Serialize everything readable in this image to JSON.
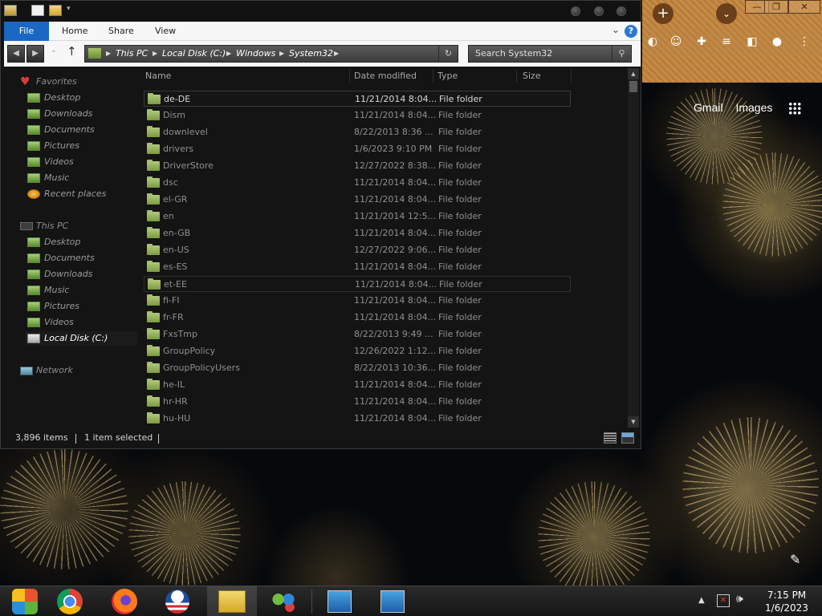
{
  "explorer": {
    "ribbon": {
      "tabs": [
        "File",
        "Home",
        "Share",
        "View"
      ],
      "help": "?"
    },
    "address": {
      "crumbs": [
        "This PC",
        "Local Disk (C:)",
        "Windows",
        "System32"
      ]
    },
    "search": {
      "placeholder": "Search System32"
    },
    "nav": {
      "favorites_label": "Favorites",
      "favorites": [
        "Desktop",
        "Downloads",
        "Documents",
        "Pictures",
        "Videos",
        "Music",
        "Recent places"
      ],
      "thispc_label": "This PC",
      "thispc": [
        "Desktop",
        "Documents",
        "Downloads",
        "Music",
        "Pictures",
        "Videos",
        "Local Disk (C:)"
      ],
      "network_label": "Network"
    },
    "columns": {
      "name": "Name",
      "date": "Date modified",
      "type": "Type",
      "size": "Size"
    },
    "rows": [
      {
        "name": "de-DE",
        "date": "11/21/2014 8:04...",
        "type": "File folder"
      },
      {
        "name": "Dism",
        "date": "11/21/2014 8:04...",
        "type": "File folder"
      },
      {
        "name": "downlevel",
        "date": "8/22/2013 8:36 ...",
        "type": "File folder"
      },
      {
        "name": "drivers",
        "date": "1/6/2023 9:10 PM",
        "type": "File folder"
      },
      {
        "name": "DriverStore",
        "date": "12/27/2022 8:38...",
        "type": "File folder"
      },
      {
        "name": "dsc",
        "date": "11/21/2014 8:04...",
        "type": "File folder"
      },
      {
        "name": "el-GR",
        "date": "11/21/2014 8:04...",
        "type": "File folder"
      },
      {
        "name": "en",
        "date": "11/21/2014 12:5...",
        "type": "File folder"
      },
      {
        "name": "en-GB",
        "date": "11/21/2014 8:04...",
        "type": "File folder"
      },
      {
        "name": "en-US",
        "date": "12/27/2022 9:06...",
        "type": "File folder"
      },
      {
        "name": "es-ES",
        "date": "11/21/2014 8:04...",
        "type": "File folder"
      },
      {
        "name": "et-EE",
        "date": "11/21/2014 8:04...",
        "type": "File folder"
      },
      {
        "name": "fi-FI",
        "date": "11/21/2014 8:04...",
        "type": "File folder"
      },
      {
        "name": "fr-FR",
        "date": "11/21/2014 8:04...",
        "type": "File folder"
      },
      {
        "name": "FxsTmp",
        "date": "8/22/2013 9:49 ...",
        "type": "File folder"
      },
      {
        "name": "GroupPolicy",
        "date": "12/26/2022 1:12...",
        "type": "File folder"
      },
      {
        "name": "GroupPolicyUsers",
        "date": "8/22/2013 10:36...",
        "type": "File folder"
      },
      {
        "name": "he-IL",
        "date": "11/21/2014 8:04...",
        "type": "File folder"
      },
      {
        "name": "hr-HR",
        "date": "11/21/2014 8:04...",
        "type": "File folder"
      },
      {
        "name": "hu-HU",
        "date": "11/21/2014 8:04...",
        "type": "File folder"
      }
    ],
    "status": {
      "count": "3,896 items",
      "selected": "1 item selected"
    }
  },
  "chrome": {
    "links": [
      "Gmail",
      "Images"
    ]
  },
  "taskbar": {
    "apps": [
      "start-orb",
      "chrome",
      "firefox",
      "obama-logo",
      "file-explorer",
      "network-tool",
      "remote-desktop-1",
      "remote-desktop-2"
    ],
    "time": "7:15 PM",
    "date": "1/6/2023"
  },
  "colors": {
    "ribbon_file": "#1b67c4",
    "folder": "#8aaa4e",
    "chrome_frame": "#c68b47"
  }
}
